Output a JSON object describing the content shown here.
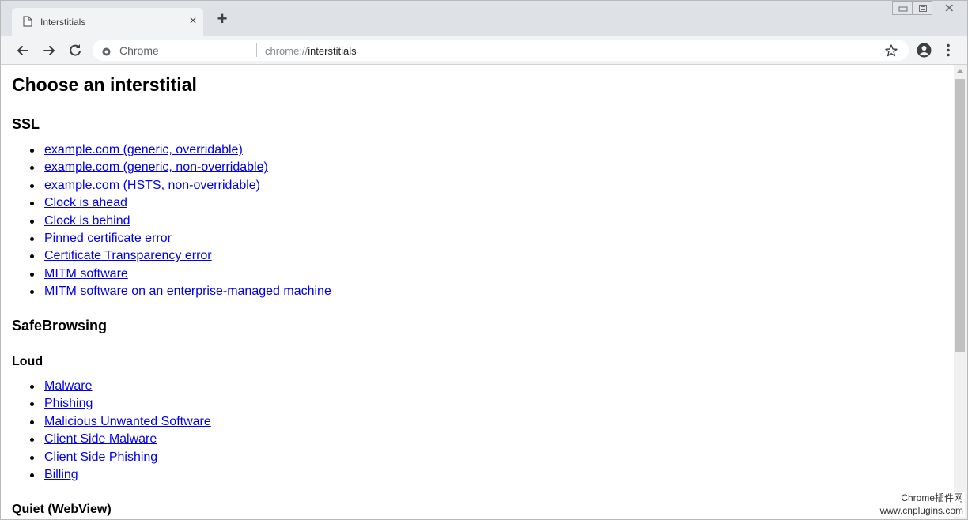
{
  "tab": {
    "title": "Interstitials",
    "close": "×"
  },
  "newtab": "+",
  "toolbar": {
    "origin_label": "Chrome",
    "url_scheme": "chrome://",
    "url_host": "interstitials"
  },
  "page": {
    "title": "Choose an interstitial",
    "ssl": {
      "heading": "SSL",
      "links": [
        "example.com (generic, overridable)",
        "example.com (generic, non-overridable)",
        "example.com (HSTS, non-overridable)",
        "Clock is ahead",
        "Clock is behind",
        "Pinned certificate error",
        "Certificate Transparency error",
        "MITM software",
        "MITM software on an enterprise-managed machine"
      ]
    },
    "safebrowsing": {
      "heading": "SafeBrowsing",
      "loud": {
        "heading": "Loud",
        "links": [
          "Malware",
          "Phishing",
          "Malicious Unwanted Software",
          "Client Side Malware",
          "Client Side Phishing",
          "Billing"
        ]
      },
      "quiet": {
        "heading": "Quiet (WebView)"
      }
    }
  },
  "watermark": {
    "line1": "Chrome插件网",
    "line2": "www.cnplugins.com"
  },
  "colors": {
    "link": "#0000ee",
    "tabstrip": "#dee1e6",
    "toolbar": "#f1f3f4"
  }
}
